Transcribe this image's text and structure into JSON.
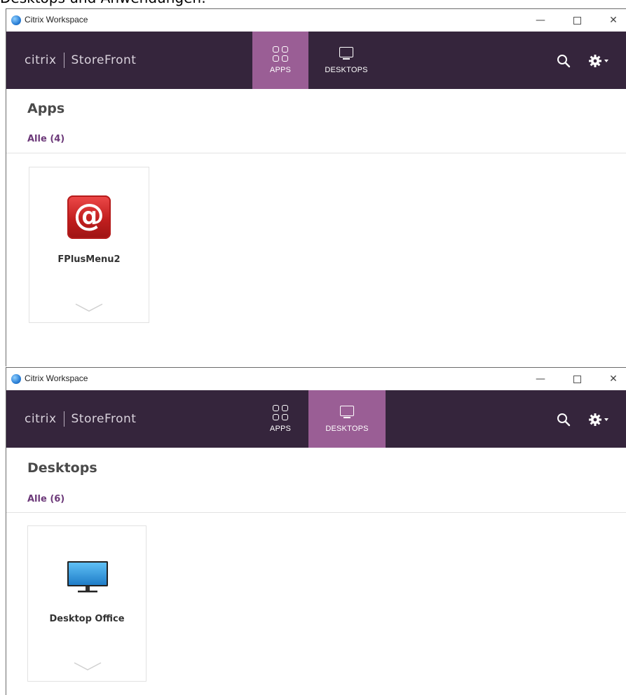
{
  "caption": "Desktops und Anwendungen:",
  "window_controls": {
    "minimize": "—",
    "close": "✕"
  },
  "windows": [
    {
      "titlebar": {
        "title": "Citrix Workspace"
      },
      "navbar": {
        "brand_citrix": "citrix",
        "brand_store": "StoreFront",
        "tabs": [
          {
            "label": "APPS",
            "icon": "apps-grid-icon",
            "active": true
          },
          {
            "label": "DESKTOPS",
            "icon": "monitor-icon",
            "active": false
          }
        ]
      },
      "page_title": "Apps",
      "filter_label": "Alle (4)",
      "tiles": [
        {
          "name": "FPlusMenu2",
          "icon": "email-at-icon"
        }
      ]
    },
    {
      "titlebar": {
        "title": "Citrix Workspace"
      },
      "navbar": {
        "brand_citrix": "citrix",
        "brand_store": "StoreFront",
        "tabs": [
          {
            "label": "APPS",
            "icon": "apps-grid-icon",
            "active": false
          },
          {
            "label": "DESKTOPS",
            "icon": "monitor-icon",
            "active": true
          }
        ]
      },
      "page_title": "Desktops",
      "filter_label": "Alle (6)",
      "tiles": [
        {
          "name": "Desktop Office",
          "icon": "desktop-monitor-icon"
        }
      ]
    }
  ],
  "colors": {
    "navbar": "#35253c",
    "active_tab": "#9a5e95",
    "filter_link": "#6d3a7a",
    "app_icon_red": "#c21f1f",
    "desktop_screen_blue": "#3a9ee0"
  }
}
